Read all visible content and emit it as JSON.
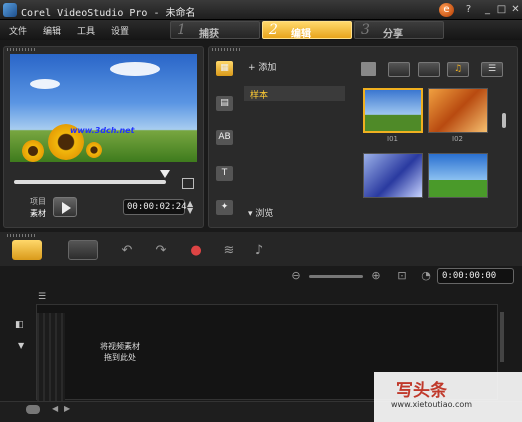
{
  "window": {
    "title": "Corel VideoStudio Pro - 未命名"
  },
  "menu": [
    "文件",
    "编辑",
    "工具",
    "设置"
  ],
  "steps": [
    {
      "num": "1",
      "label": "捕获",
      "active": false
    },
    {
      "num": "2",
      "label": "编辑",
      "active": true
    },
    {
      "num": "3",
      "label": "分享",
      "active": false
    }
  ],
  "preview": {
    "watermark": "www.3dch.net",
    "mode_project": "项目",
    "mode_clip": "素材",
    "timecode": "00:00:02:24"
  },
  "library": {
    "add_label": "添加",
    "folder_item": "样本",
    "browse_label": "浏览",
    "thumb_labels": [
      "I01",
      "I02"
    ]
  },
  "timeline": {
    "timecode": "0:00:00:00",
    "drop_hint": "将视频素材拖到此处"
  },
  "watermark": {
    "logo": "写头条",
    "url": "www.xietoutiao.com"
  },
  "colors": {
    "accent": "#f0b020",
    "bg": "#1a1a1a"
  }
}
